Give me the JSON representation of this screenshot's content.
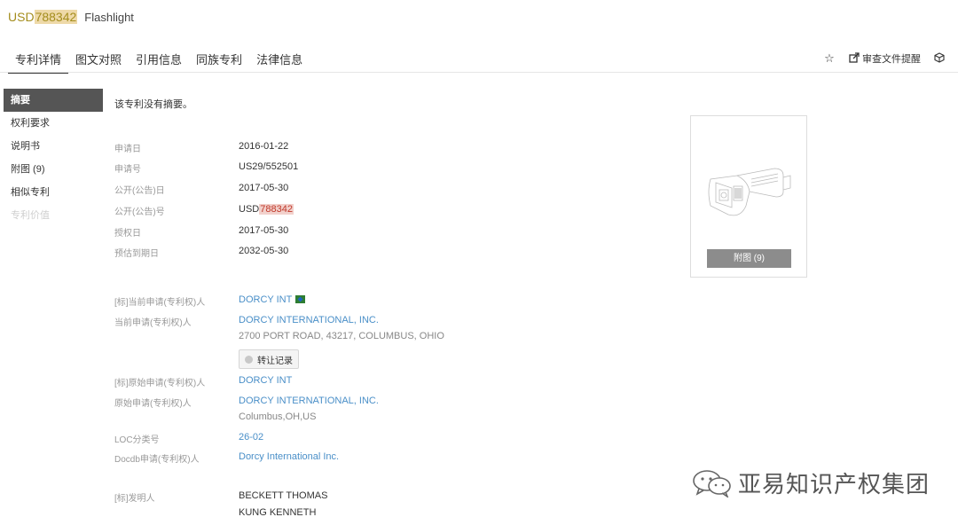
{
  "header": {
    "pn_prefix": "USD",
    "pn_highlight": "788342",
    "title": "Flashlight"
  },
  "tabs": [
    {
      "label": "专利详情",
      "active": true
    },
    {
      "label": "图文对照"
    },
    {
      "label": "引用信息"
    },
    {
      "label": "同族专利"
    },
    {
      "label": "法律信息"
    }
  ],
  "tools": {
    "star_icon": "star-icon",
    "review_label": "审查文件提醒",
    "review_icon": "export-icon",
    "cube_icon": "cube-icon"
  },
  "sidebar": [
    {
      "label": "摘要",
      "state": "active"
    },
    {
      "label": "权利要求"
    },
    {
      "label": "说明书"
    },
    {
      "label": "附图 (9)"
    },
    {
      "label": "相似专利"
    },
    {
      "label": "专利价值",
      "state": "disabled"
    }
  ],
  "abstract": "该专利没有摘要。",
  "dates": {
    "filing_date_label": "申请日",
    "filing_date": "2016-01-22",
    "app_no_label": "申请号",
    "app_no": "US29/552501",
    "pub_date_label": "公开(公告)日",
    "pub_date": "2017-05-30",
    "pub_no_label": "公开(公告)号",
    "pub_no_prefix": "USD",
    "pub_no_highlight": "788342",
    "grant_date_label": "授权日",
    "grant_date": "2017-05-30",
    "expiry_label": "预估到期日",
    "expiry_date": "2032-05-30"
  },
  "parties": {
    "std_current_label": "[标]当前申请(专利权)人",
    "std_current": "DORCY INT",
    "current_label": "当前申请(专利权)人",
    "current": "DORCY INTERNATIONAL, INC.",
    "current_address": "2700 PORT ROAD, 43217, COLUMBUS, OHIO",
    "transfer_label": "转让记录",
    "std_original_label": "[标]原始申请(专利权)人",
    "std_original": "DORCY INT",
    "original_label": "原始申请(专利权)人",
    "original": "DORCY INTERNATIONAL, INC.",
    "original_address": "Columbus,OH,US",
    "loc_label": "LOC分类号",
    "loc": "26-02",
    "docdb_label": "Docdb申请(专利权)人",
    "docdb": "Dorcy International Inc.",
    "inventor_label": "[标]发明人",
    "inventors": [
      "BECKETT THOMAS",
      "KUNG KENNETH"
    ]
  },
  "figure": {
    "button_label": "附图 (9)"
  },
  "watermark": {
    "text": "亚易知识产权集团",
    "icon": "wechat-icon"
  }
}
